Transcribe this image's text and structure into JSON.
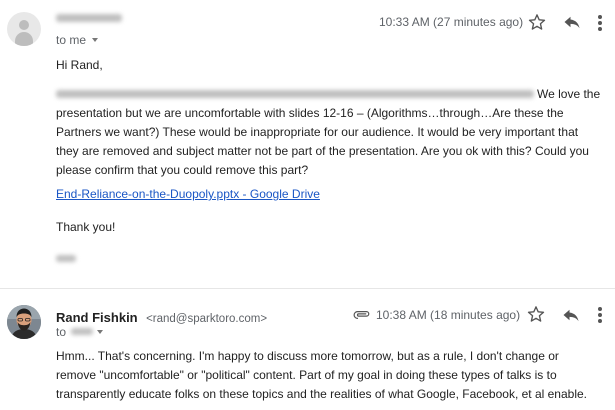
{
  "message1": {
    "timestamp": "10:33 AM (27 minutes ago)",
    "recipient": "to me",
    "greeting": "Hi Rand,",
    "paragraph": "We love the presentation but we are uncomfortable with slides 12-16 – (Algorithms…through…Are these the Partners we want?) These would be inappropriate for our audience. It would be very important that they are removed and subject matter not be part of the presentation. Are you ok with this? Could you please confirm that you could remove this part?",
    "link_text": "End-Reliance-on-the-Duopoly.pptx - Google Drive",
    "closing": "Thank you!"
  },
  "message2": {
    "sender_name": "Rand Fishkin",
    "sender_email": "<rand@sparktoro.com>",
    "timestamp": "10:38 AM (18 minutes ago)",
    "recipient": "to",
    "body": "Hmm... That's concerning. I'm happy to discuss more tomorrow, but as a rule, I don't change or remove \"uncomfortable\" or \"political\" content. Part of my goal in doing these types of talks is to transparently educate folks on these topics and the realities of what Google, Facebook, et al enable."
  },
  "icons": {
    "star": "star-icon",
    "reply": "reply-icon",
    "more": "more-vert-icon",
    "attachment": "attachment-icon"
  },
  "colors": {
    "link": "#1a56c5",
    "meta_text": "#5f6368",
    "redaction": "#bfbfbf"
  }
}
